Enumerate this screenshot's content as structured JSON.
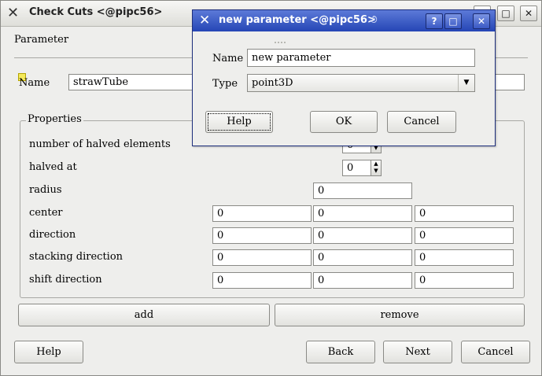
{
  "main": {
    "title": "Check Cuts <@pipc56>",
    "parameter_section": "Parameter",
    "name_label": "Name",
    "name_value": "strawTube",
    "properties_legend": "Properties",
    "rows": [
      {
        "label": "number of halved elements",
        "values": [
          "0"
        ]
      },
      {
        "label": "halved at",
        "values": [
          "0"
        ]
      },
      {
        "label": "radius",
        "values": [
          "0"
        ]
      },
      {
        "label": "center",
        "values": [
          "0",
          "0",
          "0"
        ]
      },
      {
        "label": "direction",
        "values": [
          "0",
          "0",
          "0"
        ]
      },
      {
        "label": "stacking direction",
        "values": [
          "0",
          "0",
          "0"
        ]
      },
      {
        "label": "shift direction",
        "values": [
          "0",
          "0",
          "0"
        ]
      }
    ],
    "add_label": "add",
    "remove_label": "remove",
    "help_label": "Help",
    "back_label": "Back",
    "next_label": "Next",
    "cancel_label": "Cancel"
  },
  "dialog": {
    "title": "new parameter <@pipc56>",
    "name_label": "Name",
    "name_value": "new parameter",
    "type_label": "Type",
    "type_value": "point3D",
    "help_label": "Help",
    "ok_label": "OK",
    "cancel_label": "Cancel"
  },
  "icons": {
    "app": "x-logo-icon",
    "help": "question-icon",
    "maximize": "maximize-icon",
    "close": "close-icon",
    "spin_up": "arrow-up-icon",
    "spin_down": "arrow-down-icon",
    "dropdown": "chevron-down-icon"
  }
}
